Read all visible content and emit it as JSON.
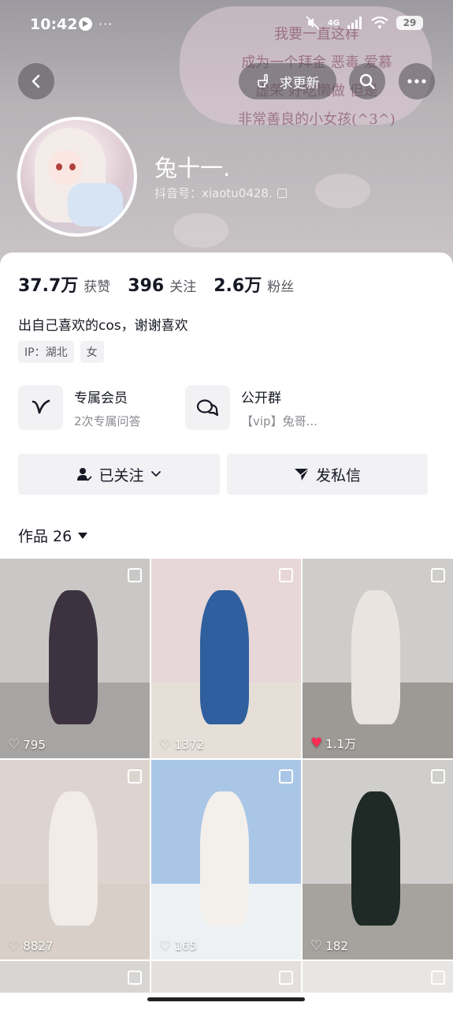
{
  "status_bar": {
    "time": "10:42",
    "dots": "···",
    "network": "4G",
    "battery": "29"
  },
  "header": {
    "update_label": "求更新",
    "banner_text": "我要一直这样\n成为一个拜金 恶毒 爱慕\n虚荣 好吃懒做 但是\n非常善良的小女孩(^3^)"
  },
  "profile": {
    "nickname": "兔十一.",
    "douyin_id": "抖音号：xiaotu0428."
  },
  "stats": [
    {
      "value": "37.7万",
      "label": "获赞"
    },
    {
      "value": "396",
      "label": "关注"
    },
    {
      "value": "2.6万",
      "label": "粉丝"
    }
  ],
  "bio": "出自己喜欢的cos，谢谢喜欢",
  "tags": [
    "IP：湖北",
    "女"
  ],
  "features": [
    {
      "title": "专属会员",
      "subtitle": "2次专属问答",
      "icon": "v-member-icon"
    },
    {
      "title": "公开群",
      "subtitle": "【vip】兔哥...",
      "icon": "group-chat-icon"
    }
  ],
  "actions": {
    "follow_label": "已关注",
    "message_label": "发私信"
  },
  "works": {
    "label": "作品 26"
  },
  "tiles": [
    {
      "likes": "795",
      "liked": false,
      "bg": "#c9c8c6",
      "fig": "#3d3340",
      "floor": "#a7a5a3"
    },
    {
      "likes": "1372",
      "liked": false,
      "bg": "#e8d7d8",
      "fig": "#2f5f9e",
      "floor": "#e6dfd8"
    },
    {
      "likes": "1.1万",
      "liked": true,
      "bg": "#cfcdcb",
      "fig": "#e9e4df",
      "floor": "#9d9a96"
    },
    {
      "likes": "8827",
      "liked": false,
      "bg": "#ddd4d0",
      "fig": "#f1ece8",
      "floor": "#d8d0c8"
    },
    {
      "likes": "165",
      "liked": false,
      "bg": "#a9c6e6",
      "fig": "#f3f0ec",
      "floor": "#eef1f4"
    },
    {
      "likes": "182",
      "liked": false,
      "bg": "#cfcecc",
      "fig": "#1f2a26",
      "floor": "#a6a39f"
    },
    {
      "likes": "",
      "liked": false,
      "bg": "#d8d6d4",
      "fig": "#d8d6d4",
      "floor": "#d8d6d4"
    },
    {
      "likes": "",
      "liked": false,
      "bg": "#e4dfdc",
      "fig": "#e4dfdc",
      "floor": "#e4dfdc"
    },
    {
      "likes": "",
      "liked": false,
      "bg": "#e8e6e4",
      "fig": "#e8e6e4",
      "floor": "#e8e6e4"
    }
  ],
  "colors": {
    "heart_liked": "#fe2c55"
  }
}
